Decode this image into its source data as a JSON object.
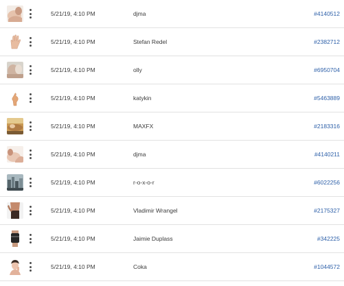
{
  "rows": [
    {
      "date": "5/21/19, 4:10 PM",
      "author": "djma",
      "id": "#4140512",
      "thumb_icon": "shoulder-photo-thumbnail",
      "thumb_colors": [
        "#e8c9b4",
        "#b98a72"
      ]
    },
    {
      "date": "5/21/19, 4:10 PM",
      "author": "Stefan Redel",
      "id": "#2382712",
      "thumb_icon": "hand-photo-thumbnail",
      "thumb_colors": [
        "#ffffff",
        "#e4b89a"
      ]
    },
    {
      "date": "5/21/19, 4:10 PM",
      "author": "olly",
      "id": "#6950704",
      "thumb_icon": "portrait-photo-thumbnail",
      "thumb_colors": [
        "#d9d6cf",
        "#c9a48f"
      ]
    },
    {
      "date": "5/21/19, 4:10 PM",
      "author": "katykin",
      "id": "#5463889",
      "thumb_icon": "hand-gesture-photo-thumbnail",
      "thumb_colors": [
        "#ffffff",
        "#e0a679"
      ]
    },
    {
      "date": "5/21/19, 4:10 PM",
      "author": "MAXFX",
      "id": "#2183316",
      "thumb_icon": "massage-photo-thumbnail",
      "thumb_colors": [
        "#d8b06a",
        "#8a6a3c"
      ]
    },
    {
      "date": "5/21/19, 4:10 PM",
      "author": "djma",
      "id": "#4140211",
      "thumb_icon": "shoulder-photo-thumbnail",
      "thumb_colors": [
        "#efd6c6",
        "#c18e78"
      ]
    },
    {
      "date": "5/21/19, 4:10 PM",
      "author": "r-o-x-o-r",
      "id": "#6022256",
      "thumb_icon": "city-photo-thumbnail",
      "thumb_colors": [
        "#7d8f97",
        "#4b5a60"
      ]
    },
    {
      "date": "5/21/19, 4:10 PM",
      "author": "Vladimir Wrangel",
      "id": "#2175327",
      "thumb_icon": "torso-photo-thumbnail",
      "thumb_colors": [
        "#f2f2f2",
        "#5a4036"
      ]
    },
    {
      "date": "5/21/19, 4:10 PM",
      "author": "Jaimie Duplass",
      "id": "#342225",
      "thumb_icon": "knee-brace-photo-thumbnail",
      "thumb_colors": [
        "#ffffff",
        "#2b2b2b"
      ]
    },
    {
      "date": "5/21/19, 4:10 PM",
      "author": "Coka",
      "id": "#1044572",
      "thumb_icon": "woman-face-photo-thumbnail",
      "thumb_colors": [
        "#ffffff",
        "#e7b8a2"
      ]
    }
  ],
  "colors": {
    "text": "#3a3a3a",
    "link": "#2c5fa8",
    "divider": "#e1e1e1"
  }
}
